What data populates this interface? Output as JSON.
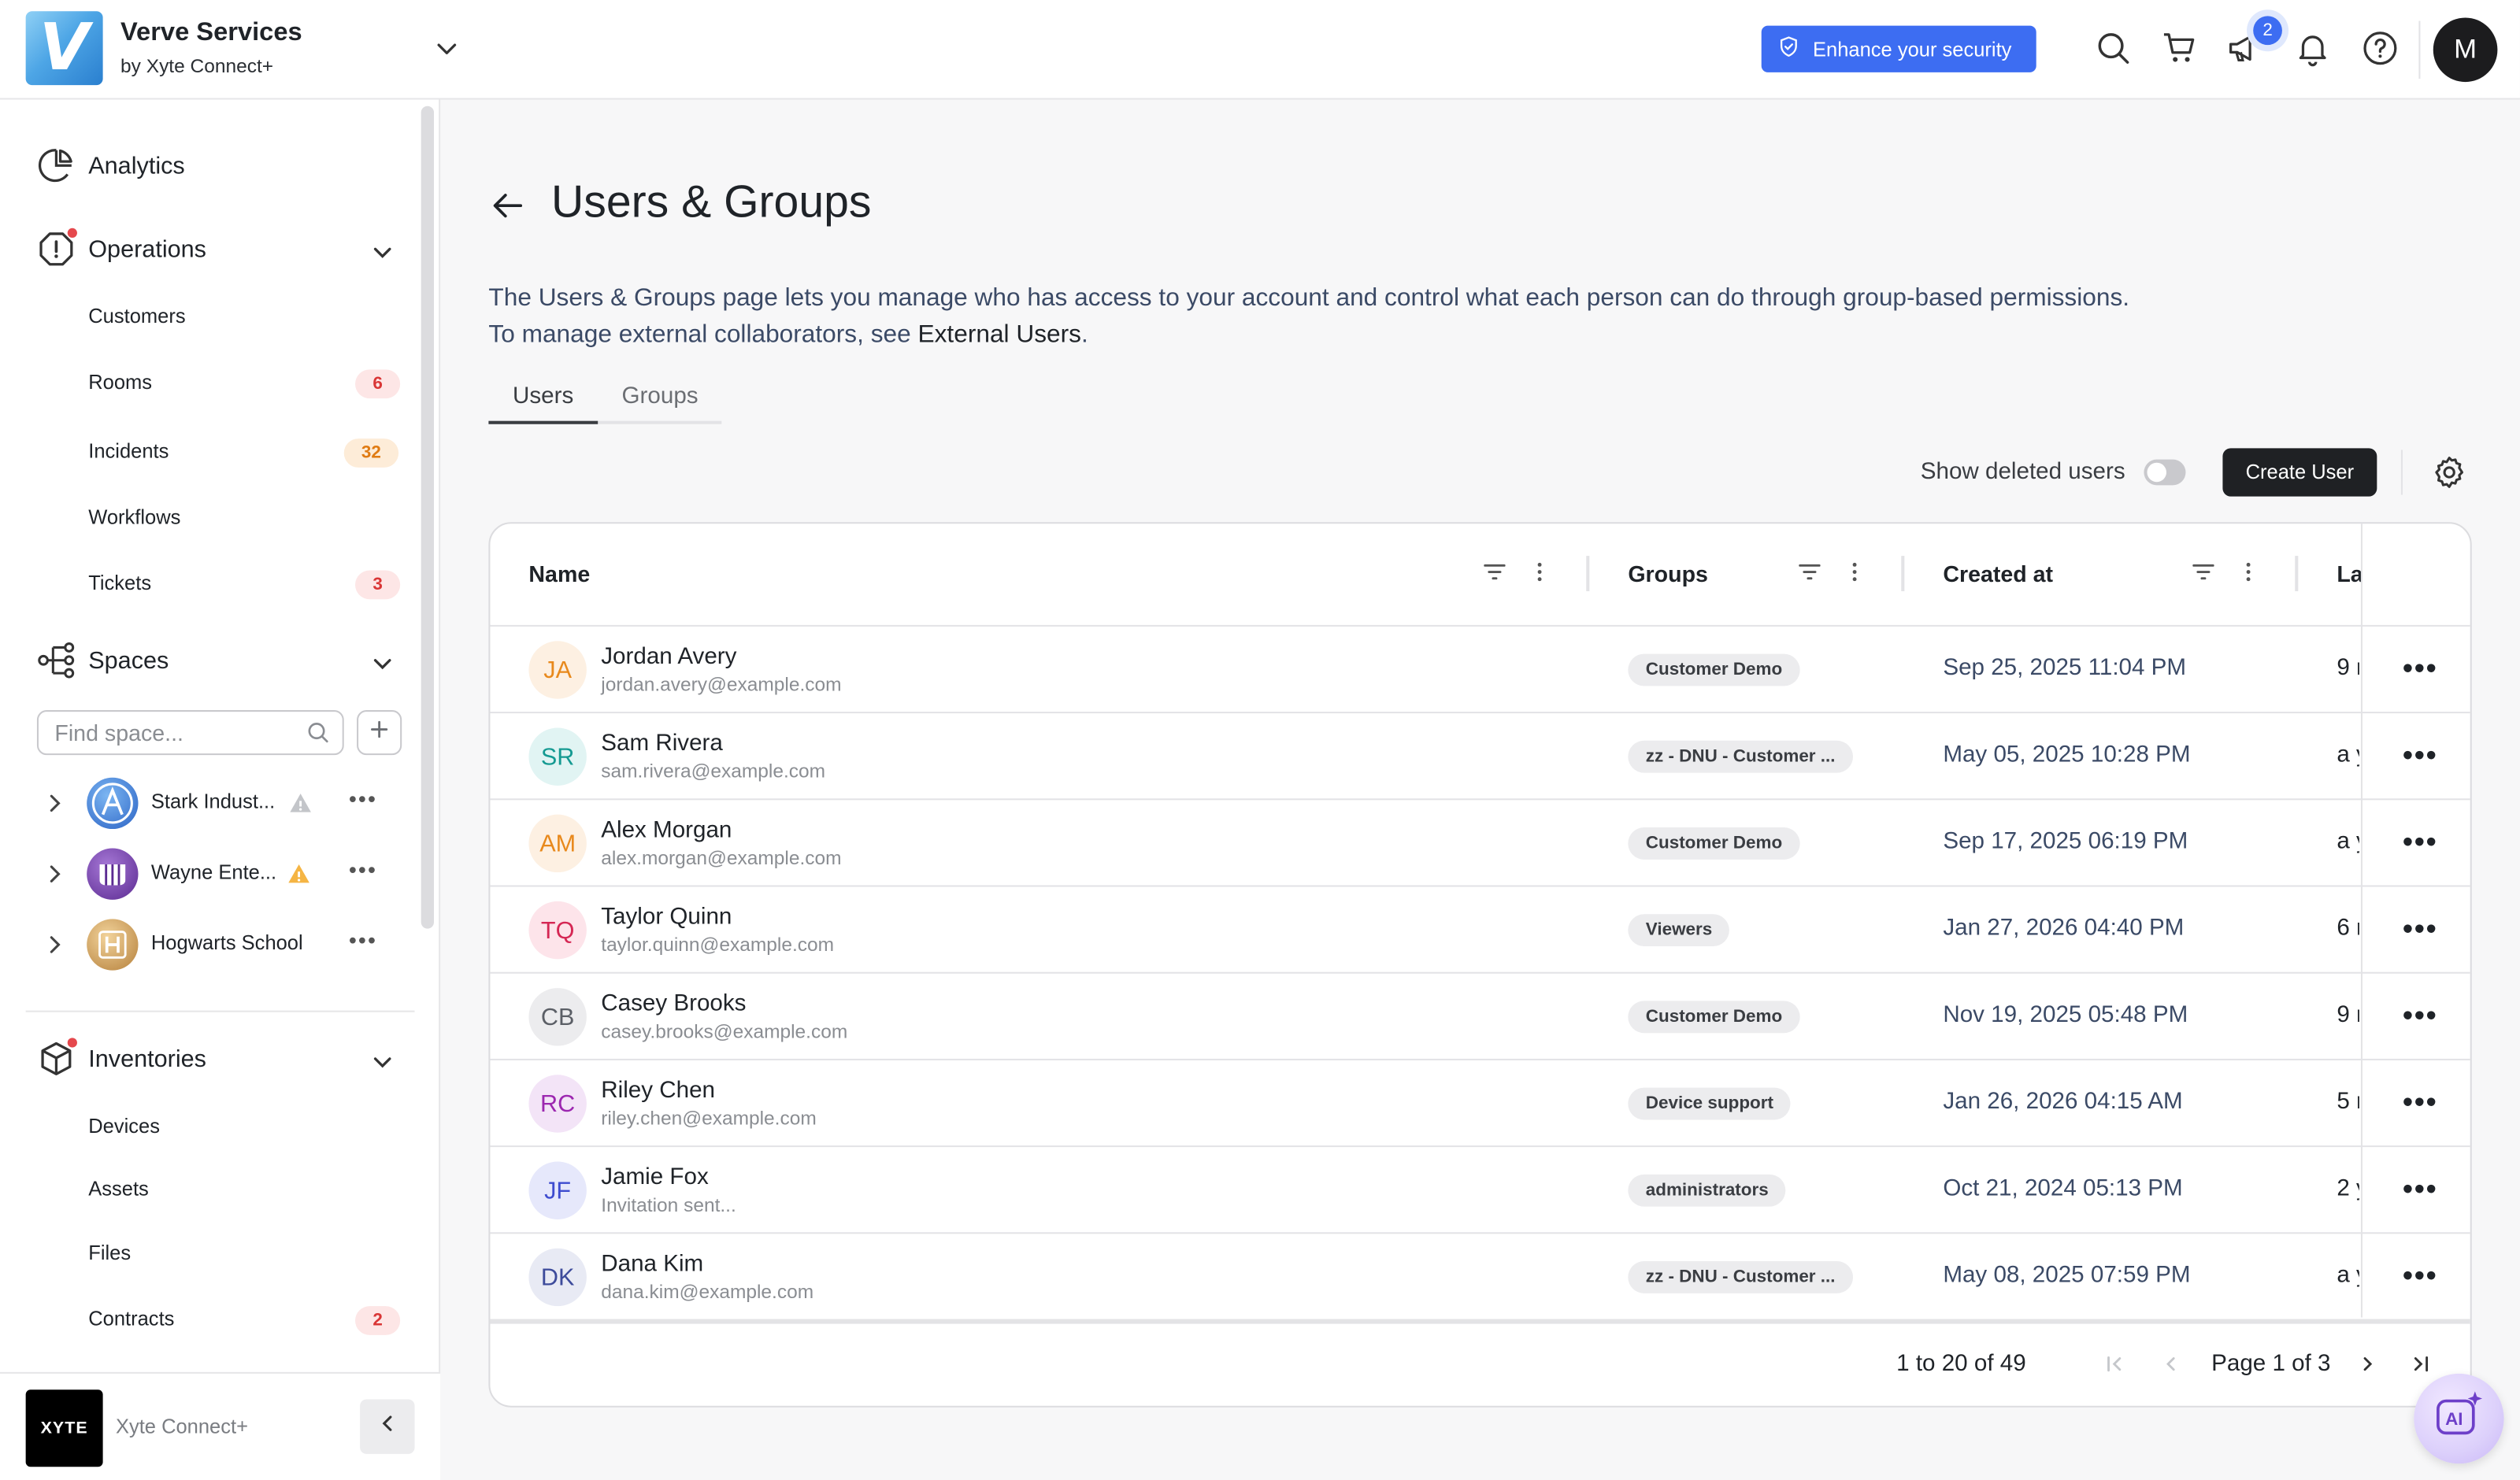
{
  "app": {
    "name": "Verve Services",
    "subtitle": "by Xyte Connect+",
    "logo_letter": "V"
  },
  "header": {
    "enhance_label": "Enhance your security",
    "notifications_count": "2",
    "avatar_initial": "M",
    "icons": [
      "search-icon",
      "cart-icon",
      "megaphone-icon",
      "bell-icon",
      "help-icon"
    ]
  },
  "sidebar": {
    "analytics": "Analytics",
    "operations": {
      "label": "Operations",
      "items": [
        {
          "label": "Customers",
          "count": ""
        },
        {
          "label": "Rooms",
          "count": "6"
        },
        {
          "label": "Incidents",
          "count": "32"
        },
        {
          "label": "Workflows",
          "count": ""
        },
        {
          "label": "Tickets",
          "count": "3"
        }
      ]
    },
    "spaces": {
      "label": "Spaces",
      "search_placeholder": "Find space...",
      "items": [
        {
          "name": "Stark Indust...",
          "warning": "gray"
        },
        {
          "name": "Wayne Ente...",
          "warning": "orange"
        },
        {
          "name": "Hogwarts School",
          "warning": ""
        }
      ]
    },
    "inventories": {
      "label": "Inventories",
      "items": [
        {
          "label": "Devices",
          "count": ""
        },
        {
          "label": "Assets",
          "count": ""
        },
        {
          "label": "Files",
          "count": ""
        },
        {
          "label": "Contracts",
          "count": "2"
        }
      ]
    },
    "footer": {
      "logo_text": "XYTE",
      "name": "Xyte Connect+"
    }
  },
  "main": {
    "title": "Users & Groups",
    "description_line1": "The Users & Groups page lets you manage who has access to your account and control what each person can do through group-based permissions.",
    "description_line2_prefix": "To manage external collaborators, see ",
    "description_link": "External Users",
    "description_line2_suffix": ".",
    "tabs": [
      {
        "label": "Users",
        "active": true
      },
      {
        "label": "Groups",
        "active": false
      }
    ],
    "show_deleted_label": "Show deleted users",
    "create_user_label": "Create User"
  },
  "table": {
    "columns": [
      "Name",
      "Groups",
      "Created at",
      "La"
    ],
    "rows": [
      {
        "initials": "JA",
        "name": "Jordan Avery",
        "email": "jordan.avery@example.com",
        "group": "Customer Demo",
        "created": "Sep 25, 2025 11:04 PM",
        "last": "9 r",
        "av_bg": "#fdf0e2",
        "av_fg": "#e8891c"
      },
      {
        "initials": "SR",
        "name": "Sam Rivera",
        "email": "sam.rivera@example.com",
        "group": "zz - DNU - Customer ...",
        "created": "May 05, 2025 10:28 PM",
        "last": "a y",
        "av_bg": "#e1f4f3",
        "av_fg": "#159a92"
      },
      {
        "initials": "AM",
        "name": "Alex Morgan",
        "email": "alex.morgan@example.com",
        "group": "Customer Demo",
        "created": "Sep 17, 2025 06:19 PM",
        "last": "a y",
        "av_bg": "#fdf0e2",
        "av_fg": "#e8891c"
      },
      {
        "initials": "TQ",
        "name": "Taylor Quinn",
        "email": "taylor.quinn@example.com",
        "group": "Viewers",
        "created": "Jan 27, 2026 04:40 PM",
        "last": "6 r",
        "av_bg": "#fde4ea",
        "av_fg": "#d52754"
      },
      {
        "initials": "CB",
        "name": "Casey Brooks",
        "email": "casey.brooks@example.com",
        "group": "Customer Demo",
        "created": "Nov 19, 2025 05:48 PM",
        "last": "9 r",
        "av_bg": "#ececee",
        "av_fg": "#5b5f66"
      },
      {
        "initials": "RC",
        "name": "Riley Chen",
        "email": "riley.chen@example.com",
        "group": "Device support",
        "created": "Jan 26, 2026 04:15 AM",
        "last": "5 r",
        "av_bg": "#f3e4f7",
        "av_fg": "#9c27b0"
      },
      {
        "initials": "JF",
        "name": "Jamie Fox",
        "email": "Invitation sent...",
        "group": "administrators",
        "created": "Oct 21, 2024 05:13 PM",
        "last": "2 y",
        "av_bg": "#e6e8fb",
        "av_fg": "#3e4ccf"
      },
      {
        "initials": "DK",
        "name": "Dana Kim",
        "email": "dana.kim@example.com",
        "group": "zz - DNU - Customer ...",
        "created": "May 08, 2025 07:59 PM",
        "last": "a y",
        "av_bg": "#e8eaf4",
        "av_fg": "#3d4b9b"
      }
    ],
    "pagination": {
      "range": "1 to 20 of 49",
      "page": "Page 1 of 3"
    }
  },
  "colors": {
    "accent": "#3d6df2",
    "danger": "#e5484d"
  }
}
